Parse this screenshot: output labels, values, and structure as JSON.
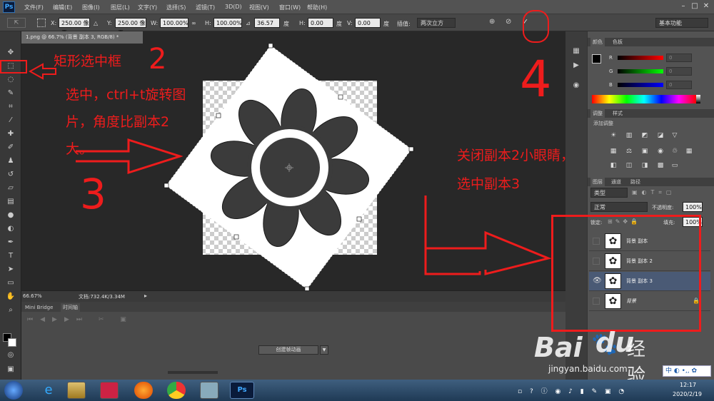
{
  "menu": {
    "logo": "Ps",
    "items": [
      "文件(F)",
      "编辑(E)",
      "图像(I)",
      "图层(L)",
      "文字(Y)",
      "选择(S)",
      "滤镜(T)",
      "3D(D)",
      "视图(V)",
      "窗口(W)",
      "帮助(H)"
    ]
  },
  "options": {
    "x_label": "X:",
    "x_value": "250.00 像素",
    "y_label": "Y:",
    "y_value": "250.00 像素",
    "w_label": "W:",
    "w_value": "100.00%",
    "h_label": "H:",
    "h_value": "100.00%",
    "angle_value": "36.57",
    "angle_unit": "度",
    "hskew_label": "H:",
    "hskew_value": "0.00",
    "hskew_unit": "度",
    "vskew_label": "V:",
    "vskew_value": "0.00",
    "vskew_unit": "度",
    "interp_label": "插值:",
    "interp_value": "两次立方",
    "workspace": "基本功能"
  },
  "doc_tab": "1.png @ 66.7% (背景 副本 3, RGB/8) *",
  "status": {
    "zoom": "66.67%",
    "doc": "文档:732.4K/3.34M"
  },
  "timeline": {
    "tabs": [
      "Mini Bridge",
      "时间轴"
    ],
    "create_button": "创建帧动画"
  },
  "panels": {
    "color_tabs": [
      "颜色",
      "色板"
    ],
    "r_label": "R",
    "g_label": "G",
    "b_label": "B",
    "r_value": "0",
    "g_value": "0",
    "b_value": "0",
    "adj_tabs": [
      "调整",
      "样式"
    ],
    "adj_title": "添加调整",
    "layer_tabs": [
      "图层",
      "通道",
      "路径"
    ],
    "kind": "类型",
    "blend": "正常",
    "opacity_label": "不透明度:",
    "opacity": "100%",
    "lock_label": "锁定:",
    "fill_label": "填充:",
    "fill": "100%"
  },
  "layers": [
    {
      "name": "背景 副本",
      "visible": false,
      "selected": false
    },
    {
      "name": "背景 副本 2",
      "visible": false,
      "selected": false
    },
    {
      "name": "背景 副本 3",
      "visible": true,
      "selected": true
    },
    {
      "name": "背景",
      "visible": false,
      "selected": false
    }
  ],
  "annotations": {
    "a1": "矩形选中框",
    "a2": "选中，ctrl+t旋转图",
    "a3": "片，角度比副本2",
    "a4": "大。",
    "a5": "关闭副本2小眼睛，",
    "a6": "选中副本3",
    "n2": "2",
    "n3": "3",
    "n4": "4"
  },
  "watermark": {
    "brand": "Bai",
    "brand2": "du",
    "jingyan": "经验",
    "url": "jingyan.baidu.com"
  },
  "ime": {
    "lang": "中"
  },
  "clock": {
    "time": "12:17",
    "date": "2020/2/19"
  },
  "colors": {
    "annotation": "#ee1c1c",
    "selected_layer": "#4a5a75",
    "panel": "#535353"
  }
}
